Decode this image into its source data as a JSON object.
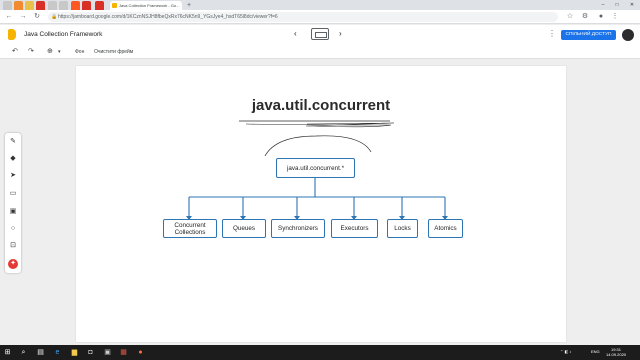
{
  "browser": {
    "tab_title": "Java Collection Framework - Go...",
    "url": "https://jamboard.google.com/d/1KCznNSJH8fbeQxRx76cNK5n9_YGsJye4_hsdT65l8dc/viewer?f=6",
    "new_tab": "+",
    "win_minimize": "–",
    "win_maximize": "□",
    "win_close": "✕"
  },
  "app": {
    "title": "Java Collection Framework",
    "share_label": "СПІЛЬНИЙ ДОСТУП",
    "prev_frame": "‹",
    "next_frame": "›",
    "more": "⋮"
  },
  "toolbar": {
    "undo": "↶",
    "redo": "↷",
    "zoom": "⊕",
    "zoom_caret": "▾",
    "background_label": "Фон",
    "clear_label": "Очистити фрейм"
  },
  "tools": {
    "pen": "✎",
    "eraser": "◆",
    "select": "➤",
    "sticky": "▭",
    "image": "▣",
    "shape": "○",
    "textbox": "⊡",
    "laser": "✦"
  },
  "board": {
    "heading": "java.util.concurrent",
    "root": "java.util.concurrent.*",
    "children": [
      [
        "Concurrent",
        "Collections"
      ],
      [
        "Queues"
      ],
      [
        "Synchronizers"
      ],
      [
        "Executors"
      ],
      [
        "Locks"
      ],
      [
        "Atomics"
      ]
    ]
  },
  "tray": {
    "lang": "ENG",
    "time": "19:31",
    "date": "14.09.2020"
  }
}
